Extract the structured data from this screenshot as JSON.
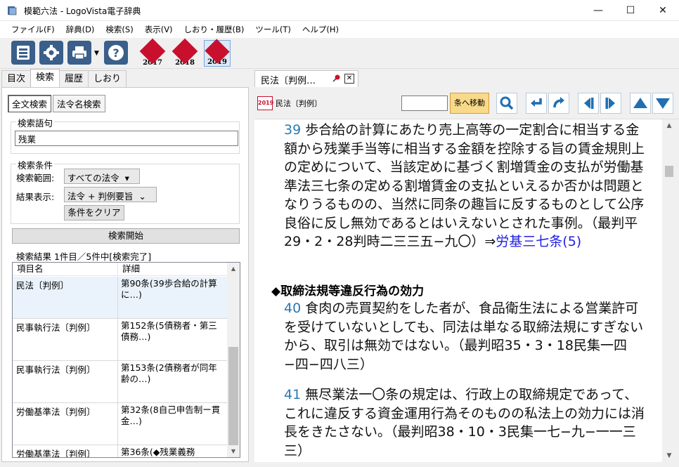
{
  "window": {
    "title": "模範六法 - LogoVista電子辞典",
    "minimize": "—",
    "maximize": "☐",
    "close": "✕"
  },
  "menu": [
    "ファイル(F)",
    "辞典(D)",
    "検索(S)",
    "表示(V)",
    "しおり・履歴(B)",
    "ツール(T)",
    "ヘルプ(H)"
  ],
  "toolbar": {
    "books": [
      {
        "label": "模範六法",
        "year": "2017"
      },
      {
        "label": "模範六法",
        "year": "2018"
      },
      {
        "label": "模範六法",
        "year": "2019"
      }
    ]
  },
  "left": {
    "tabs": [
      "目次",
      "検索",
      "履歴",
      "しおり"
    ],
    "subtabs": [
      "全文検索",
      "法令名検索"
    ],
    "query_group": "検索語句",
    "query_value": "残業",
    "cond_group": "検索条件",
    "range_label": "検索範囲:",
    "range_value": "すべての法令",
    "range_arrow": "▾",
    "display_label": "結果表示:",
    "display_value": "法令 + 判例要旨",
    "display_arrow": "⌄",
    "clear_button": "条件をクリア",
    "start_button": "検索開始",
    "result_status": "検索結果 1件目／5件中[検索完了]",
    "columns": [
      "項目名",
      "詳細"
    ],
    "rows": [
      {
        "name": "民法〔判例〕",
        "detail": "第90条(39歩合給の計算に…)"
      },
      {
        "name": "民事執行法〔判例〕",
        "detail": "第152条(5債務者・第三債務…)"
      },
      {
        "name": "民事執行法〔判例〕",
        "detail": "第153条(2債務者が同年齢の…)"
      },
      {
        "name": "労働基準法〔判例〕",
        "detail": "第32条(8自己申告制ー貫金…)"
      },
      {
        "name": "労働基準法〔判例〕",
        "detail": "第36条(◆残業義務"
      }
    ],
    "scroll_up": "▲",
    "scroll_down": "▼"
  },
  "right": {
    "tab_label": "民法〔判例…",
    "tab_close": "✕",
    "doc_year": "2019",
    "doc_label": "民法〔判例〕",
    "article_input": "",
    "go_button": "条へ移動",
    "scroll_up": "▲",
    "scroll_down": "▼",
    "paragraphs": [
      {
        "num": "39",
        "text": " 歩合給の計算にあたり売上高等の一定割合に相当する金額から残業手当等に相当する金額を控除する旨の賃金規則上の定めについて、当該定めに基づく割増賃金の支払が労働基準法三七条の定める割増賃金の支払といえるか否かは問題となりうるものの、当然に同条の趣旨に反するものとして公序良俗に反し無効であるとはいえないとされた事例。（最判平29・2・28判時二三三五−九〇）⇒",
        "link": "労基三七条(5)"
      },
      {
        "heading": "◆取締法規等違反行為の効力"
      },
      {
        "num": "40",
        "text": " 食肉の売買契約をした者が、食品衛生法による営業許可を受けていないとしても、同法は単なる取締法規にすぎないから、取引は無効ではない。（最判昭35・3・18民集一四−四−四八三）"
      },
      {
        "num": "41",
        "text": " 無尽業法一〇条の規定は、行政上の取締規定であって、これに違反する資金運用行為そのものの私法上の効力には消長をきたさない。（最判昭38・10・3民集一七−九−一一三三）"
      }
    ]
  }
}
